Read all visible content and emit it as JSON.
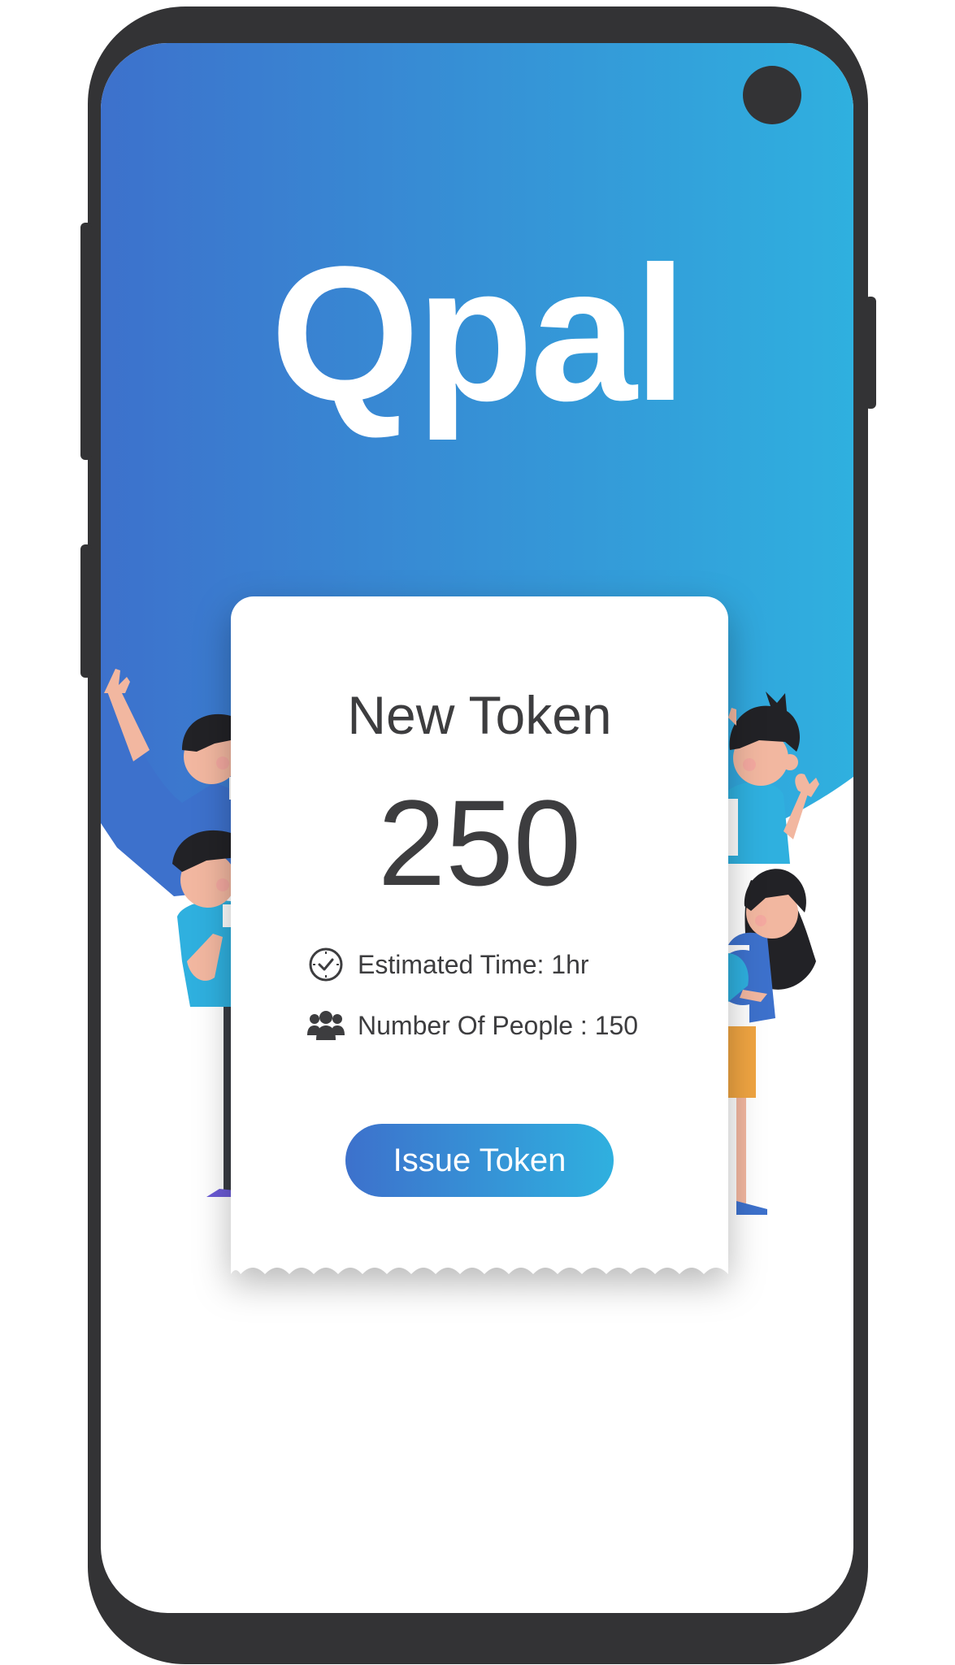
{
  "app": {
    "title": "Qpal"
  },
  "token_card": {
    "heading": "New Token",
    "number": "250",
    "estimated_time": "Estimated Time: 1hr",
    "number_of_people": "Number Of People : 150",
    "issue_button_label": "Issue Token"
  },
  "icons": {
    "clock": "clock-icon",
    "people": "people-group-icon"
  },
  "colors": {
    "gradient_start": "#3d71cc",
    "gradient_end": "#2fb0df",
    "phone_frame": "#333335",
    "text_dark": "#3d3d3f",
    "text_light": "#ffffff"
  }
}
